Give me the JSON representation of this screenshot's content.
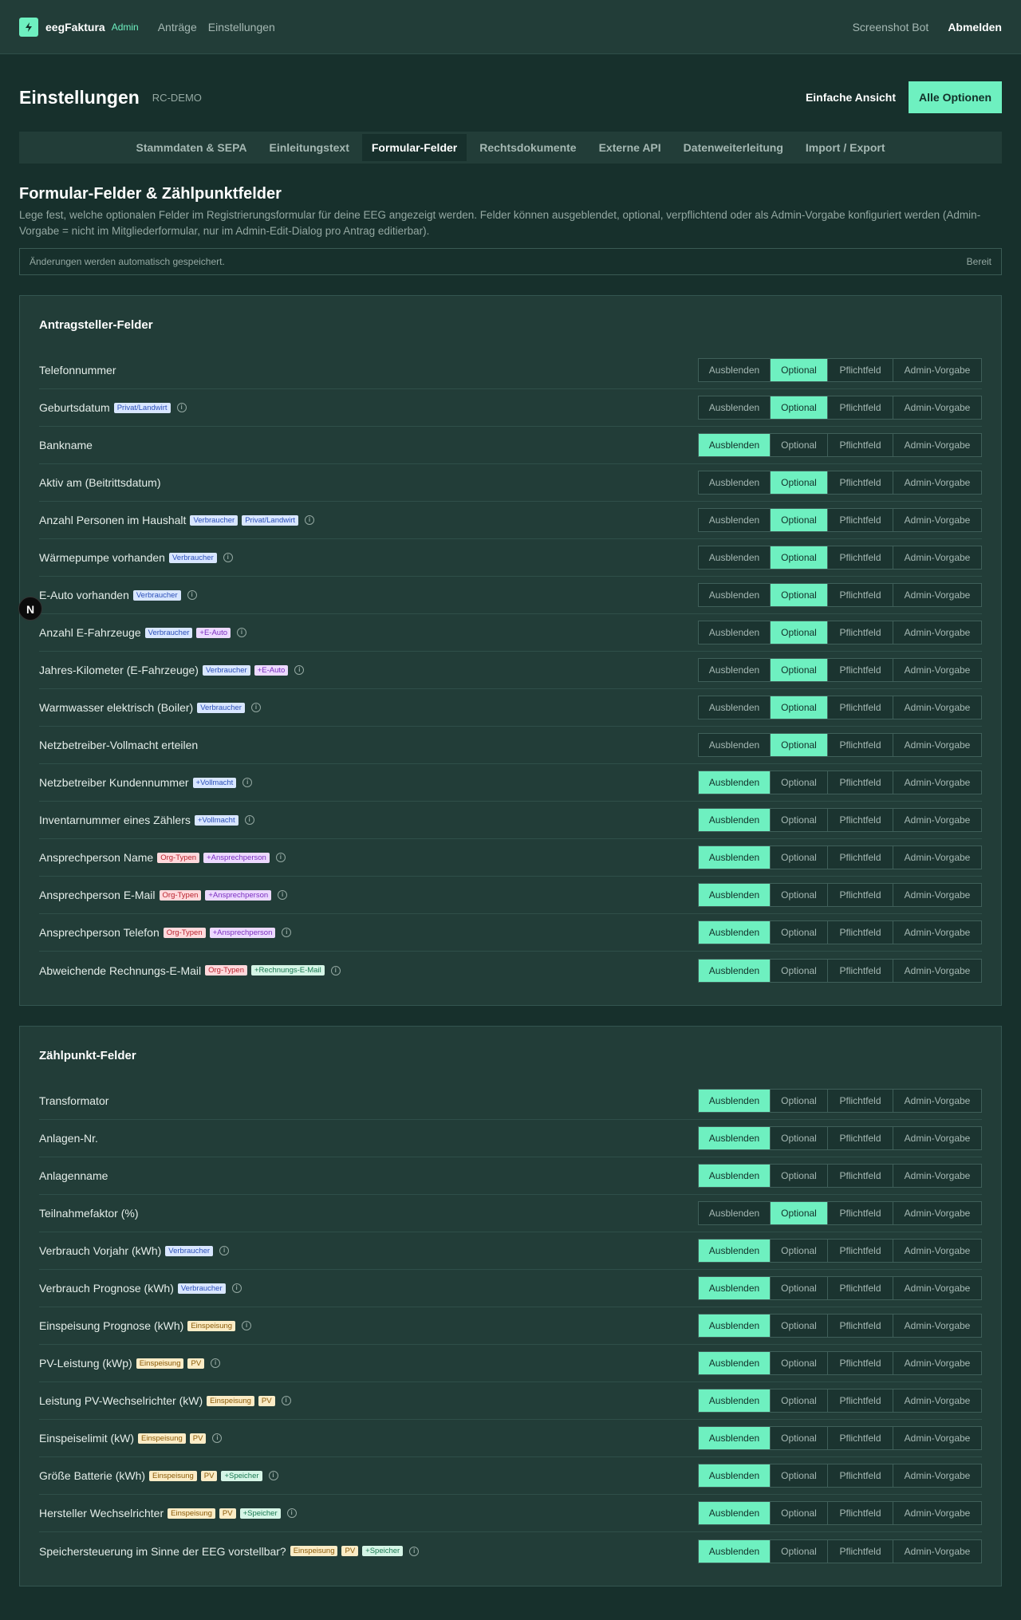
{
  "nav": {
    "brand": "eegFaktura",
    "brand_badge": "Admin",
    "links": [
      "Anträge",
      "Einstellungen"
    ],
    "user": "Screenshot Bot",
    "logout": "Abmelden"
  },
  "header": {
    "title": "Einstellungen",
    "tenant": "RC-DEMO",
    "simple_view": "Einfache Ansicht",
    "all_options": "Alle Optionen"
  },
  "tabs": [
    {
      "label": "Stammdaten & SEPA",
      "active": false
    },
    {
      "label": "Einleitungstext",
      "active": false
    },
    {
      "label": "Formular-Felder",
      "active": true
    },
    {
      "label": "Rechtsdokumente",
      "active": false
    },
    {
      "label": "Externe API",
      "active": false
    },
    {
      "label": "Datenweiterleitung",
      "active": false
    },
    {
      "label": "Import / Export",
      "active": false
    }
  ],
  "intro": {
    "title": "Formular-Felder & Zählpunktfelder",
    "description": "Lege fest, welche optionalen Felder im Registrierungsformular für deine EEG angezeigt werden. Felder können ausgeblendet, optional, verpflichtend oder als Admin-Vorgabe konfiguriert werden (Admin-Vorgabe = nicht im Mitgliederformular, nur im Admin-Edit-Dialog pro Antrag editierbar).",
    "autosave": "Änderungen werden automatisch gespeichert.",
    "autosave_state": "Bereit"
  },
  "options": [
    "Ausblenden",
    "Optional",
    "Pflichtfeld",
    "Admin-Vorgabe"
  ],
  "badge_colors": {
    "blue": "#d8e6ff",
    "purple": "#ecd9ff",
    "red": "#ffd9dc",
    "yellow": "#fbecc6",
    "green": "#d5f5e6"
  },
  "accent": "#6ef0c0",
  "floating_button": "N",
  "sections": [
    {
      "title": "Antragsteller-Felder",
      "fields": [
        {
          "name": "Telefonnummer",
          "badges": [],
          "info": false,
          "selected": 1
        },
        {
          "name": "Geburtsdatum",
          "badges": [
            {
              "text": "Privat/Landwirt",
              "color": "blue"
            }
          ],
          "info": true,
          "selected": 1
        },
        {
          "name": "Bankname",
          "badges": [],
          "info": false,
          "selected": 0
        },
        {
          "name": "Aktiv am (Beitrittsdatum)",
          "badges": [],
          "info": false,
          "selected": 1
        },
        {
          "name": "Anzahl Personen im Haushalt",
          "badges": [
            {
              "text": "Verbraucher",
              "color": "blue"
            },
            {
              "text": "Privat/Landwirt",
              "color": "blue"
            }
          ],
          "info": true,
          "selected": 1
        },
        {
          "name": "Wärmepumpe vorhanden",
          "badges": [
            {
              "text": "Verbraucher",
              "color": "blue"
            }
          ],
          "info": true,
          "selected": 1
        },
        {
          "name": "E-Auto vorhanden",
          "badges": [
            {
              "text": "Verbraucher",
              "color": "blue"
            }
          ],
          "info": true,
          "selected": 1
        },
        {
          "name": "Anzahl E-Fahrzeuge",
          "badges": [
            {
              "text": "Verbraucher",
              "color": "blue"
            },
            {
              "text": "+E-Auto",
              "color": "purple"
            }
          ],
          "info": true,
          "selected": 1
        },
        {
          "name": "Jahres-Kilometer (E-Fahrzeuge)",
          "badges": [
            {
              "text": "Verbraucher",
              "color": "blue"
            },
            {
              "text": "+E-Auto",
              "color": "purple"
            }
          ],
          "info": true,
          "selected": 1
        },
        {
          "name": "Warmwasser elektrisch (Boiler)",
          "badges": [
            {
              "text": "Verbraucher",
              "color": "blue"
            }
          ],
          "info": true,
          "selected": 1
        },
        {
          "name": "Netzbetreiber-Vollmacht erteilen",
          "badges": [],
          "info": false,
          "selected": 1
        },
        {
          "name": "Netzbetreiber Kundennummer",
          "badges": [
            {
              "text": "+Vollmacht",
              "color": "blue"
            }
          ],
          "info": true,
          "selected": 0
        },
        {
          "name": "Inventarnummer eines Zählers",
          "badges": [
            {
              "text": "+Vollmacht",
              "color": "blue"
            }
          ],
          "info": true,
          "selected": 0
        },
        {
          "name": "Ansprechperson Name",
          "badges": [
            {
              "text": "Org-Typen",
              "color": "red"
            },
            {
              "text": "+Ansprechperson",
              "color": "purple"
            }
          ],
          "info": true,
          "selected": 0
        },
        {
          "name": "Ansprechperson E-Mail",
          "badges": [
            {
              "text": "Org-Typen",
              "color": "red"
            },
            {
              "text": "+Ansprechperson",
              "color": "purple"
            }
          ],
          "info": true,
          "selected": 0
        },
        {
          "name": "Ansprechperson Telefon",
          "badges": [
            {
              "text": "Org-Typen",
              "color": "red"
            },
            {
              "text": "+Ansprechperson",
              "color": "purple"
            }
          ],
          "info": true,
          "selected": 0
        },
        {
          "name": "Abweichende Rechnungs-E-Mail",
          "badges": [
            {
              "text": "Org-Typen",
              "color": "red"
            },
            {
              "text": "+Rechnungs-E-Mail",
              "color": "green"
            }
          ],
          "info": true,
          "selected": 0
        }
      ]
    },
    {
      "title": "Zählpunkt-Felder",
      "fields": [
        {
          "name": "Transformator",
          "badges": [],
          "info": false,
          "selected": 0
        },
        {
          "name": "Anlagen-Nr.",
          "badges": [],
          "info": false,
          "selected": 0
        },
        {
          "name": "Anlagenname",
          "badges": [],
          "info": false,
          "selected": 0
        },
        {
          "name": "Teilnahmefaktor (%)",
          "badges": [],
          "info": false,
          "selected": 1
        },
        {
          "name": "Verbrauch Vorjahr (kWh)",
          "badges": [
            {
              "text": "Verbraucher",
              "color": "blue"
            }
          ],
          "info": true,
          "selected": 0
        },
        {
          "name": "Verbrauch Prognose (kWh)",
          "badges": [
            {
              "text": "Verbraucher",
              "color": "blue"
            }
          ],
          "info": true,
          "selected": 0
        },
        {
          "name": "Einspeisung Prognose (kWh)",
          "badges": [
            {
              "text": "Einspeisung",
              "color": "yellow"
            }
          ],
          "info": true,
          "selected": 0
        },
        {
          "name": "PV-Leistung (kWp)",
          "badges": [
            {
              "text": "Einspeisung",
              "color": "yellow"
            },
            {
              "text": "PV",
              "color": "yellow"
            }
          ],
          "info": true,
          "selected": 0
        },
        {
          "name": "Leistung PV-Wechselrichter (kW)",
          "badges": [
            {
              "text": "Einspeisung",
              "color": "yellow"
            },
            {
              "text": "PV",
              "color": "yellow"
            }
          ],
          "info": true,
          "selected": 0
        },
        {
          "name": "Einspeiselimit (kW)",
          "badges": [
            {
              "text": "Einspeisung",
              "color": "yellow"
            },
            {
              "text": "PV",
              "color": "yellow"
            }
          ],
          "info": true,
          "selected": 0
        },
        {
          "name": "Größe Batterie (kWh)",
          "badges": [
            {
              "text": "Einspeisung",
              "color": "yellow"
            },
            {
              "text": "PV",
              "color": "yellow"
            },
            {
              "text": "+Speicher",
              "color": "green"
            }
          ],
          "info": true,
          "selected": 0
        },
        {
          "name": "Hersteller Wechselrichter",
          "badges": [
            {
              "text": "Einspeisung",
              "color": "yellow"
            },
            {
              "text": "PV",
              "color": "yellow"
            },
            {
              "text": "+Speicher",
              "color": "green"
            }
          ],
          "info": true,
          "selected": 0
        },
        {
          "name": "Speichersteuerung im Sinne der EEG vorstellbar?",
          "badges": [
            {
              "text": "Einspeisung",
              "color": "yellow"
            },
            {
              "text": "PV",
              "color": "yellow"
            },
            {
              "text": "+Speicher",
              "color": "green"
            }
          ],
          "info": true,
          "selected": 0
        }
      ]
    }
  ]
}
